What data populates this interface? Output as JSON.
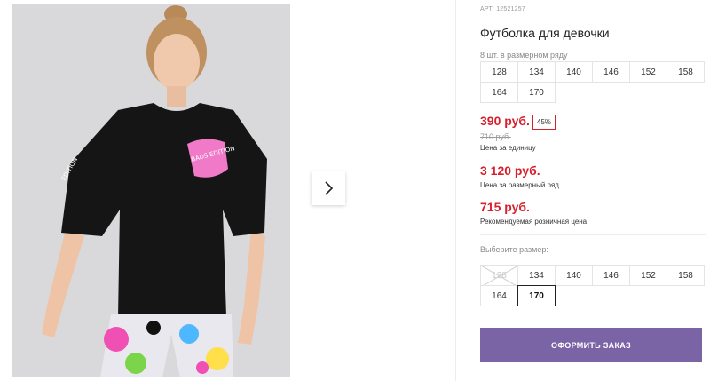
{
  "product": {
    "article": "АРТ: 12521257",
    "title": "Футболка для девочки",
    "sizes_in_row_caption": "8 шт. в размерном ряду",
    "size_row": [
      "128",
      "134",
      "140",
      "146",
      "152",
      "158",
      "164",
      "170"
    ]
  },
  "pricing": {
    "price": "390 руб.",
    "discount": "45%",
    "old_price": "710 руб.",
    "unit_caption": "Цена за единицу",
    "row_price": "3 120 руб.",
    "row_caption": "Цена за размерный ряд",
    "rrp": "715 руб.",
    "rrp_caption": "Рекомендуемая розничная цена"
  },
  "size_select": {
    "caption": "Выберите размер:",
    "options": [
      {
        "label": "128",
        "state": "unavailable"
      },
      {
        "label": "134",
        "state": "available"
      },
      {
        "label": "140",
        "state": "available"
      },
      {
        "label": "146",
        "state": "available"
      },
      {
        "label": "152",
        "state": "available"
      },
      {
        "label": "158",
        "state": "available"
      },
      {
        "label": "164",
        "state": "available"
      },
      {
        "label": "170",
        "state": "selected"
      }
    ]
  },
  "actions": {
    "order_label": "ОФОРМИТЬ ЗАКАЗ"
  },
  "colors": {
    "accent_red": "#d6202d",
    "order_button": "#7b64a6",
    "photo_background": "#d9d9db"
  },
  "icons": {
    "gallery_next": "chevron-right-icon"
  }
}
